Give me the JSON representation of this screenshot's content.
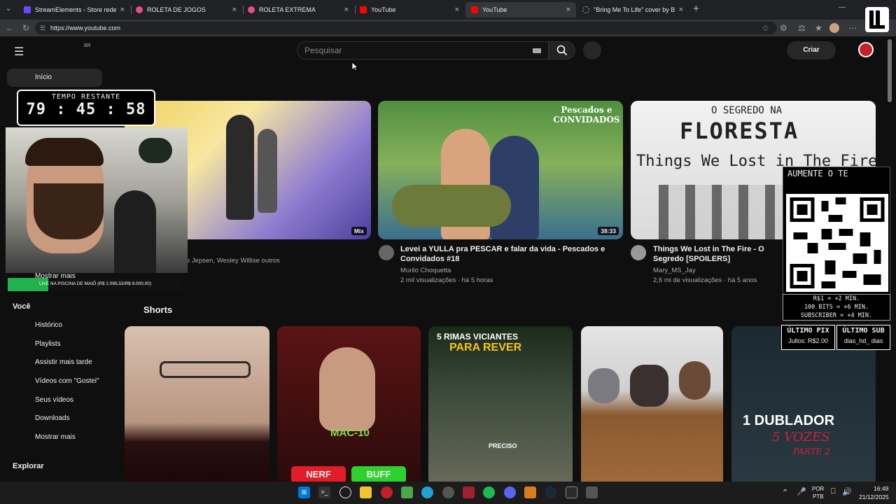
{
  "browser": {
    "tabs": [
      {
        "label": "StreamElements - Store redemptic",
        "color": "#6c47ff"
      },
      {
        "label": "ROLETA DE JOGOS",
        "color": "#e44d8a"
      },
      {
        "label": "ROLETA EXTREMA",
        "color": "#e44d8a"
      },
      {
        "label": "YouTube",
        "color": "#ff0000"
      },
      {
        "label": "YouTube",
        "color": "#ff0000"
      },
      {
        "label": "\"Bring Me To Life\" cover by Bev &",
        "color": "#9aa0a6"
      }
    ],
    "url": "https://www.youtube.com"
  },
  "youtube": {
    "country": "BR",
    "search_placeholder": "Pesquisar",
    "create_label": "Criar",
    "sidebar": {
      "home": "Início",
      "show_more_top": "Mostrar mais",
      "you_heading": "Você",
      "you_items": [
        "Histórico",
        "Playlists",
        "Assistir mais tarde",
        "Vídeos com \"Gostei\"",
        "Seus vídeos",
        "Downloads",
        "Mostrar mais"
      ],
      "explore_heading": "Explorar"
    },
    "videos": [
      {
        "title": "",
        "meta1": "e Jepsen, Wesley Willise outros",
        "meta2": "",
        "badge": "Mix"
      },
      {
        "title": "Levei a YULLA pra PESCAR e falar da vida - Pescados e Convidados #18",
        "channel": "Murilo Choquetta",
        "stats": "2 mil visualizações · há 5 horas",
        "duration": "38:33",
        "thumb_text": "Pescados e CONVIDADOS"
      },
      {
        "title": "Things We Lost in The Fire - O Segredo [SPOILERS]",
        "channel": "Mary_MS_Jay",
        "stats": "2,6 mi de visualizações · há 5 anos",
        "thumb_text_1": "O SEGREDO NA",
        "thumb_text_2": "FLORESTA",
        "thumb_text_3": "Things We Lost in The Fire"
      }
    ],
    "shorts_heading": "Shorts",
    "shorts": [
      {
        "text": ""
      },
      {
        "text": "MAC-10",
        "buttons": [
          "NERF",
          "BUFF"
        ]
      },
      {
        "text": "5 RIMAS VICIANTES",
        "text2": "PARA REVER",
        "label": "PRECISO"
      },
      {
        "text": ""
      },
      {
        "text": "1 DUBLADOR",
        "text2": "5 VOZES",
        "text3": "PARTE 2"
      }
    ]
  },
  "overlay": {
    "timer_label": "TEMPO RESTANTE",
    "timer_value": "79 : 45 : 58",
    "goal_text": "LIVE NA PISCINA DE MAIÔ (R$ 2.095,53/R$ 9.000,00)",
    "goal_progress": 0.2328,
    "qr_header": "AUMENTE O TE",
    "rates": [
      "R$1 = +2 MIN.",
      "100 BITS = +6 MIN.",
      "SUBSCRIBER = +4 MIN."
    ],
    "last_pix_label": "ÚLTIMO PIX",
    "last_sub_label": "ÚLTIMO SUB",
    "last_pix_value": "Jullos: R$2.00",
    "last_sub_value": "dias_hd_ dias"
  },
  "taskbar": {
    "lang": "POR",
    "lang2": "PTB",
    "time": "16:49",
    "date": "21/12/2025"
  }
}
